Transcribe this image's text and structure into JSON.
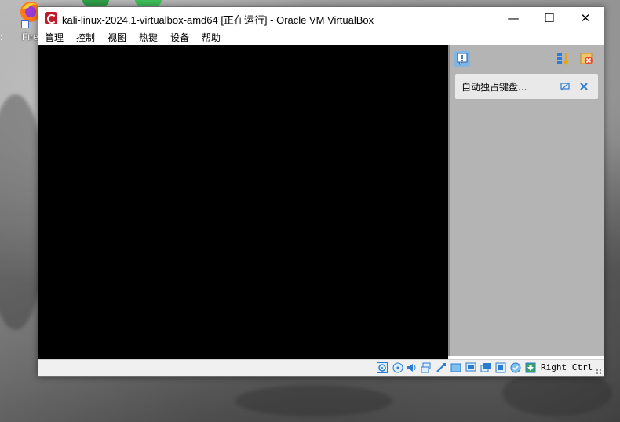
{
  "desktop": {
    "icon_label": "Fire",
    "left_edge_text": ":"
  },
  "window": {
    "title": "kali-linux-2024.1-virtualbox-amd64 [正在运行] - Oracle VM VirtualBox",
    "controls": {
      "minimize": "—",
      "maximize": "☐",
      "close": "✕"
    }
  },
  "menu": {
    "items": [
      "管理",
      "控制",
      "视图",
      "热键",
      "设备",
      "帮助"
    ]
  },
  "notification_panel": {
    "messages": [
      {
        "text": "自动独占键盘..."
      }
    ]
  },
  "statusbar": {
    "host_key": "Right Ctrl"
  },
  "colors": {
    "vm_screen": "#000000",
    "panel_bg": "#b4b4b4",
    "accent_blue": "#2b7bd1"
  }
}
